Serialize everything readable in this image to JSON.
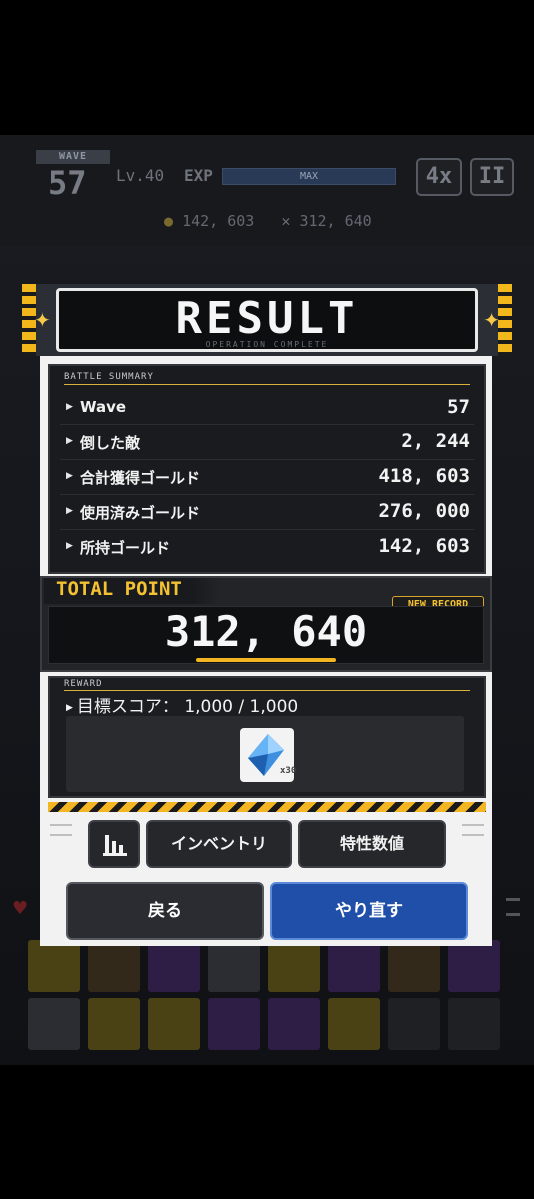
{
  "hud": {
    "wave_label": "WAVE",
    "wave_number": "57",
    "level": "Lv.40",
    "exp_label": "EXP",
    "exp_status": "MAX",
    "speed_button": "4x",
    "pause_button": "II",
    "gold": "142, 603",
    "score": "312, 640"
  },
  "result": {
    "title": "RESULT",
    "subtitle": "OPERATION COMPLETE",
    "summary_label": "BATTLE SUMMARY",
    "rows": [
      {
        "label": "Wave",
        "value": "57"
      },
      {
        "label": "倒した敵",
        "value": "2, 244"
      },
      {
        "label": "合計獲得ゴールド",
        "value": "418, 603"
      },
      {
        "label": "使用済みゴールド",
        "value": "276, 000"
      },
      {
        "label": "所持ゴールド",
        "value": "142, 603"
      }
    ],
    "total_label": "TOTAL POINT",
    "total_value": "312, 640",
    "new_record": "NEW RECORD",
    "reward_label": "REWARD",
    "goal_text": "目標スコア： 1,000 / 1,000",
    "reward_item": {
      "icon": "blue-crystal-icon",
      "quantity": "x30"
    },
    "buttons": {
      "inventory": "インベントリ",
      "traits": "特性数値",
      "back": "戻る",
      "retry": "やり直す"
    }
  },
  "colors": {
    "accent_yellow": "#f3b521",
    "retry_blue": "#1f4fa8",
    "panel_dark": "#1a1b1e",
    "modal_frame": "#f2f2f2"
  }
}
